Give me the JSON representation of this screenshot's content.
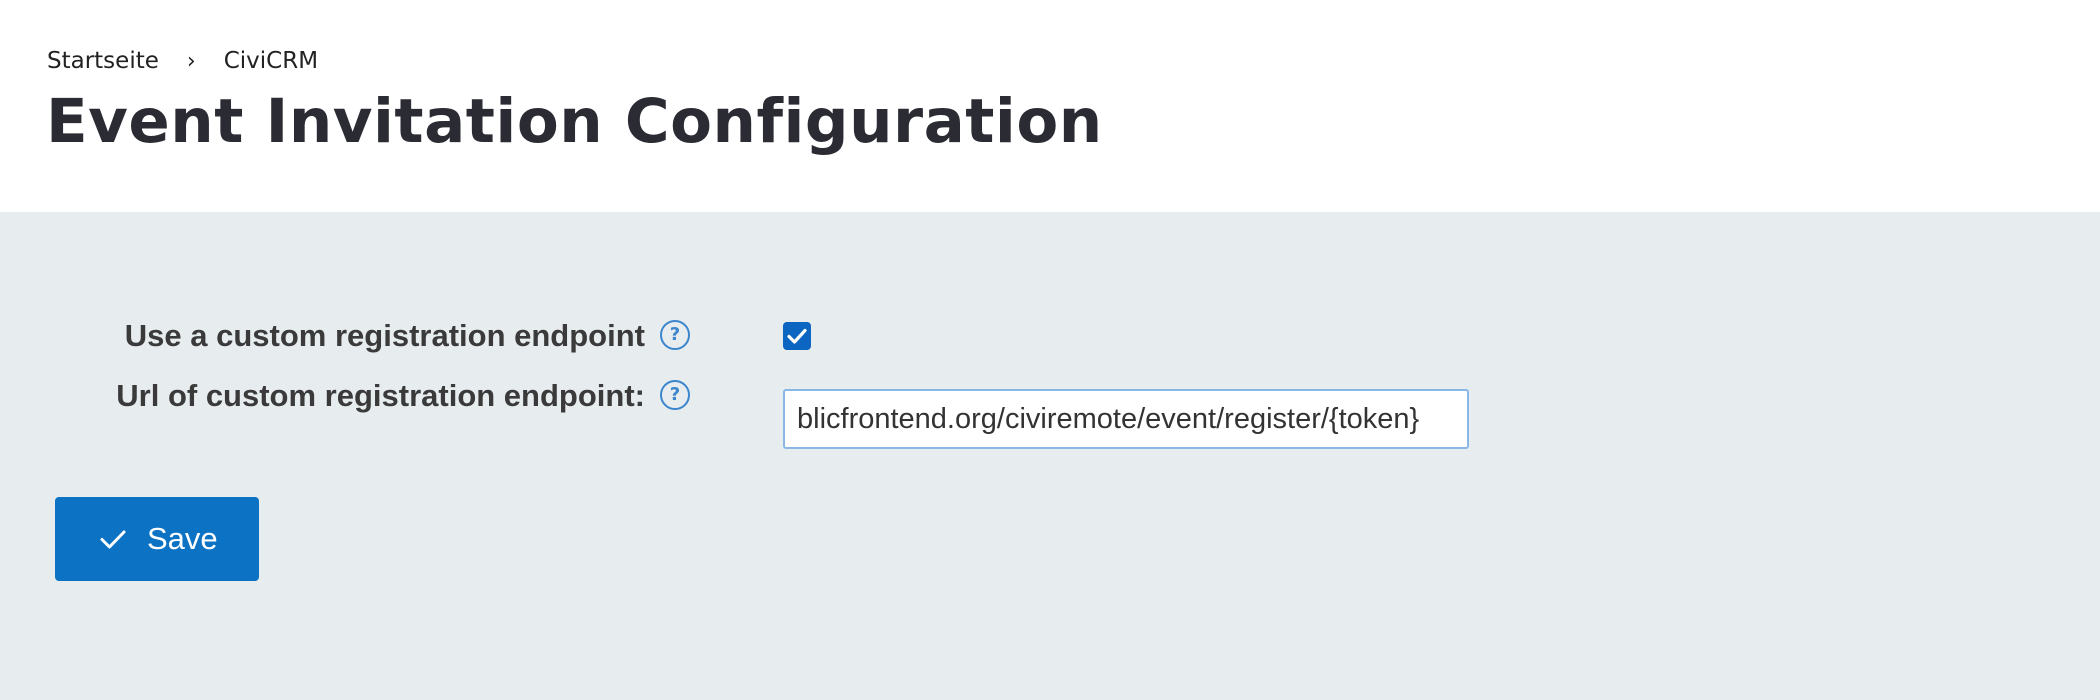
{
  "breadcrumb": {
    "items": [
      "Startseite",
      "CiviCRM"
    ],
    "separator": "›"
  },
  "page": {
    "title": "Event Invitation Configuration"
  },
  "form": {
    "custom_endpoint": {
      "label": "Use a custom registration endpoint",
      "checked": true,
      "help_icon": "question-circle-icon"
    },
    "endpoint_url": {
      "label": "Url of custom registration endpoint:",
      "value": "blicfrontend.org/civiremote/event/register/{token}",
      "help_icon": "question-circle-icon"
    }
  },
  "actions": {
    "save_label": "Save",
    "save_icon": "check-icon"
  },
  "colors": {
    "primary": "#0c72c4",
    "content_background": "#e7ecef",
    "help_icon": "#3b86cc"
  }
}
